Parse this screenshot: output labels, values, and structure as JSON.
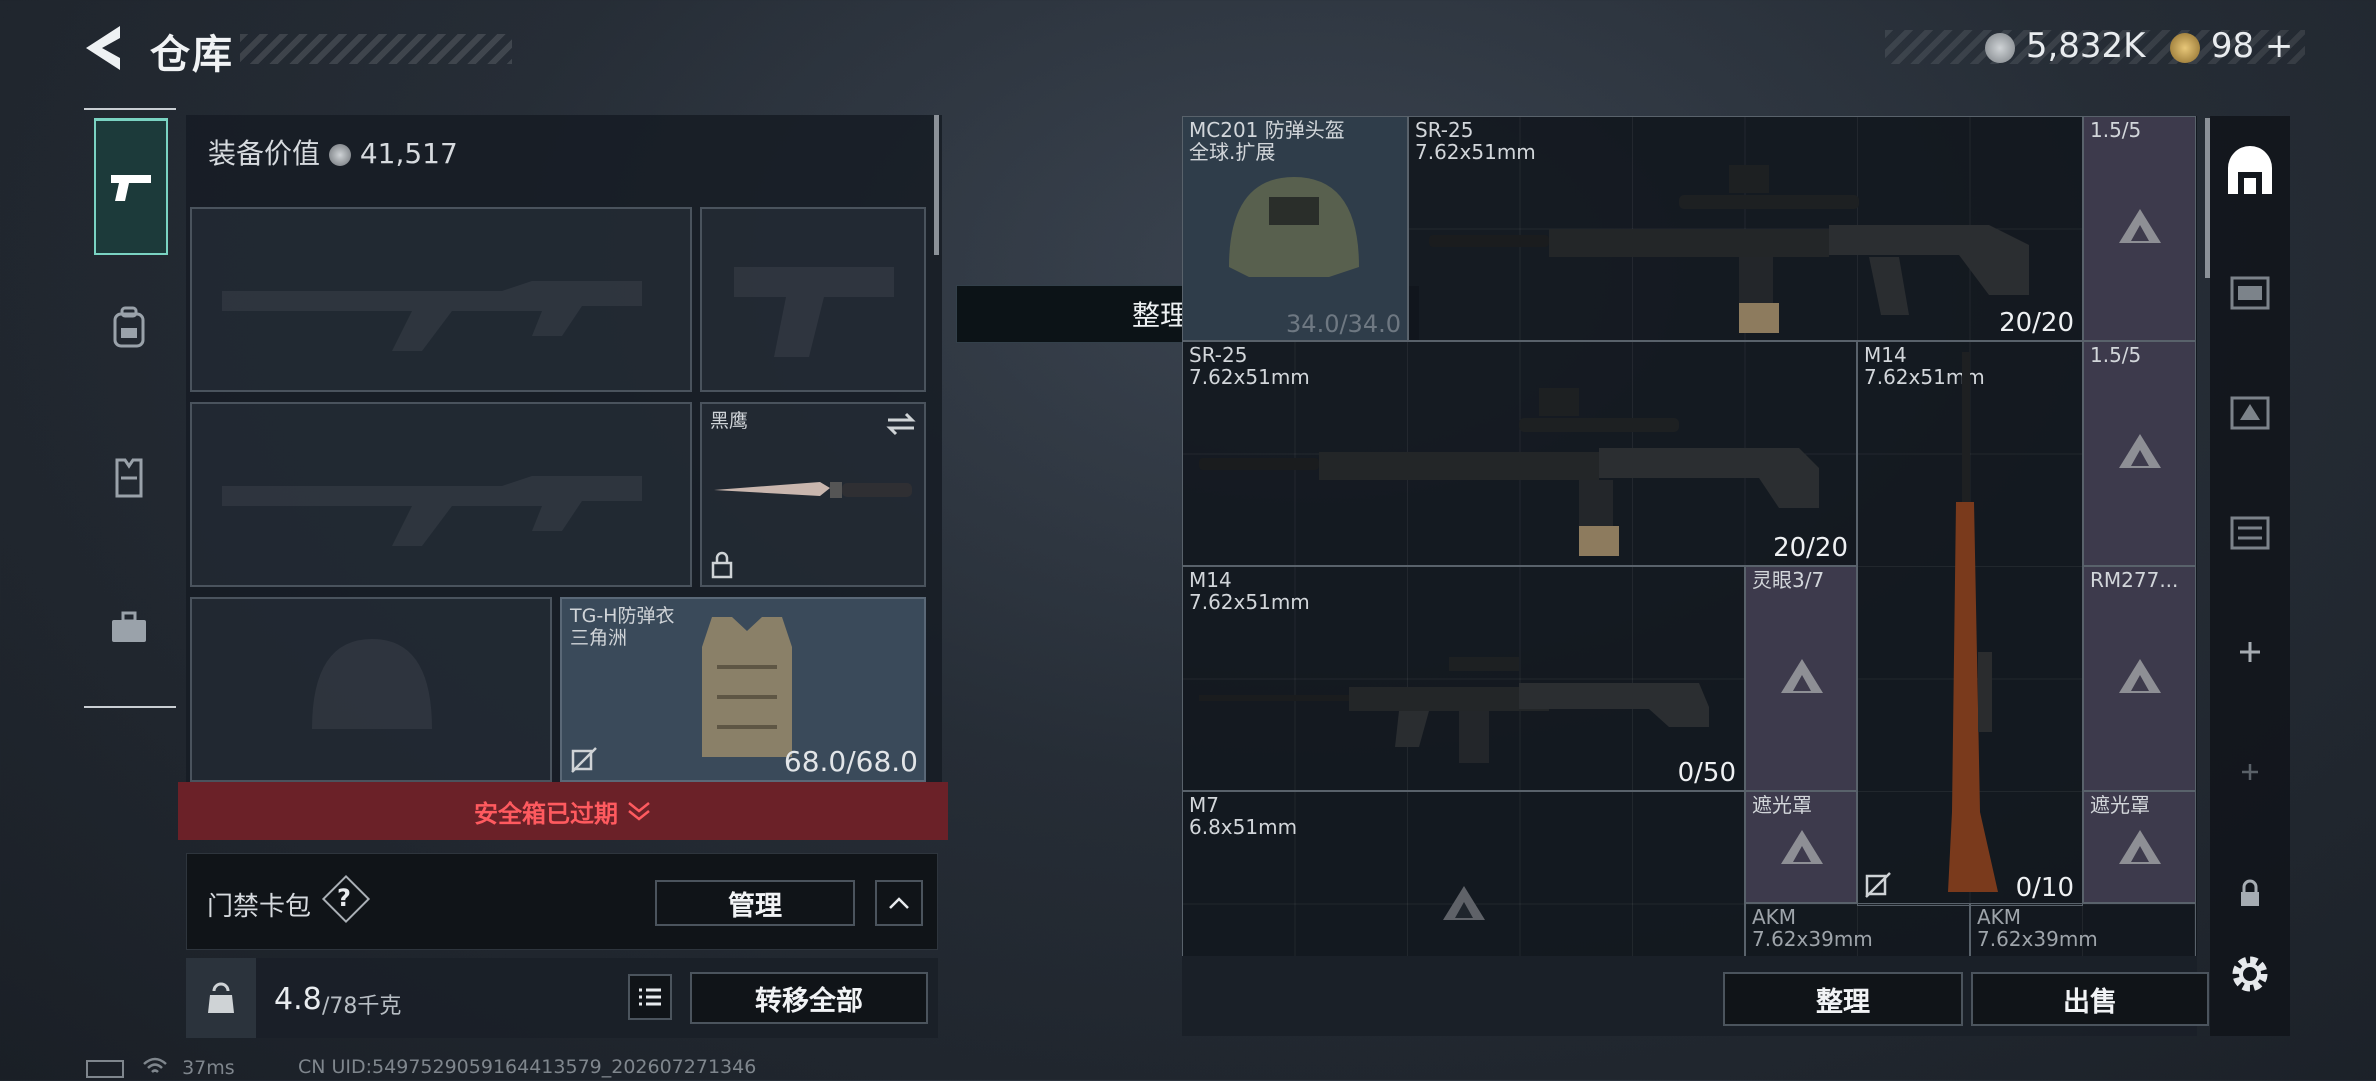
{
  "header": {
    "title": "仓库",
    "currency_silver": "5,832K",
    "currency_gold": "98",
    "plus": "+"
  },
  "tabs": [
    {
      "name": "weapons",
      "icon": "pistol-icon",
      "active": true
    },
    {
      "name": "backpack",
      "icon": "backpack-icon",
      "active": false
    },
    {
      "name": "vest",
      "icon": "chest-rig-icon",
      "active": false
    },
    {
      "name": "case",
      "icon": "briefcase-icon",
      "active": false
    }
  ],
  "equipment": {
    "value_label": "装备价值",
    "value": "41,517",
    "knife_label": "黑鹰",
    "armor_label": "TG-H防弹衣",
    "armor_sub": "三角洲",
    "armor_durability": "68.0/68.0",
    "safe_box_banner": "安全箱已过期",
    "card_bag_label": "门禁卡包",
    "help": "?",
    "manage": "管理",
    "weight": "4.8",
    "weight_max": "/78千克",
    "transfer_all": "转移全部"
  },
  "toast": "整理成功",
  "stash": {
    "items": [
      {
        "name": "MC201 防弹头盔",
        "sub": "全球.扩展",
        "value": "34.0/34.0"
      },
      {
        "name": "SR-25",
        "sub": "7.62x51mm",
        "count": "20/20"
      },
      {
        "name": "1.5/5"
      },
      {
        "name": "SR-25",
        "sub": "7.62x51mm",
        "count": "20/20"
      },
      {
        "name": "M14",
        "sub": "7.62x51mm",
        "count": "0/10"
      },
      {
        "name": "1.5/5"
      },
      {
        "name": "M14",
        "sub": "7.62x51mm",
        "count": "0/50"
      },
      {
        "name": "灵眼3/7"
      },
      {
        "name": "RM277..."
      },
      {
        "name": "M7",
        "sub": "6.8x51mm"
      },
      {
        "name": "遮光罩"
      },
      {
        "name": "遮光罩"
      },
      {
        "name": "AKM",
        "sub": "7.62x39mm"
      },
      {
        "name": "AKM",
        "sub": "7.62x39mm"
      }
    ],
    "sort": "整理",
    "sell": "出售"
  },
  "status": {
    "ping": "37ms",
    "uid": "CN UID:5497529059164413579_202607271346"
  },
  "colors": {
    "accent": "#7ad3c2",
    "danger": "#ff5a5f",
    "banner_bg": "#6b2128"
  }
}
